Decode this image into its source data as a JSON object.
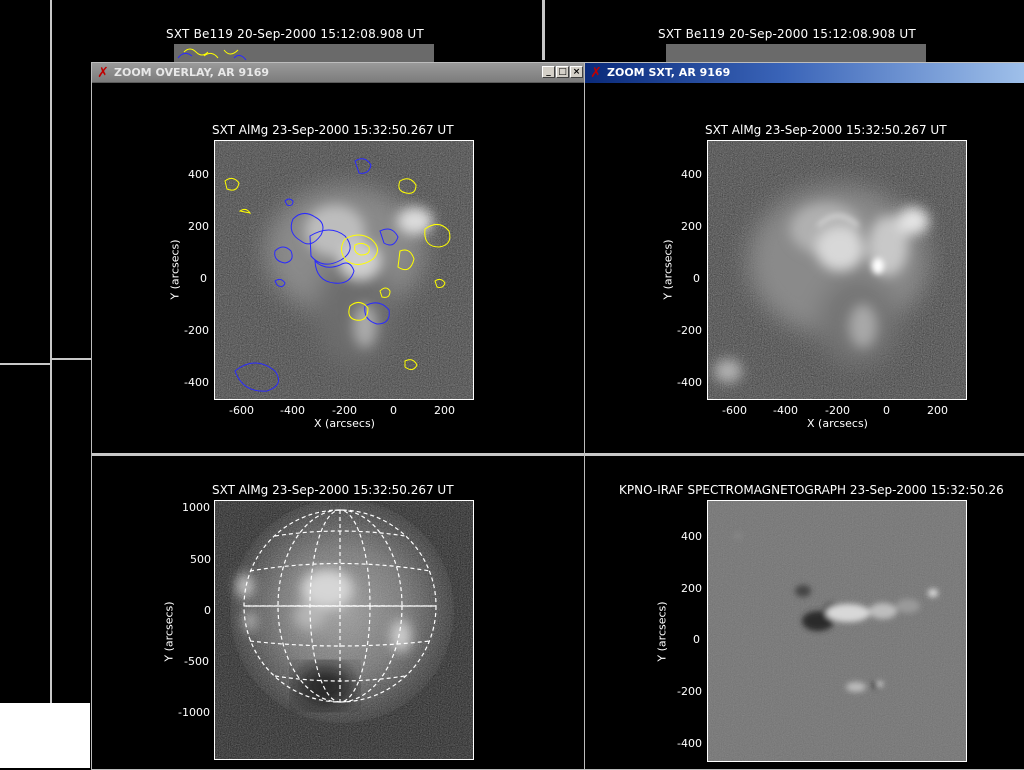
{
  "background": {
    "title_left": "SXT Be119 20-Sep-2000 15:12:08.908 UT",
    "title_right": "SXT Be119 20-Sep-2000 15:12:08.908 UT"
  },
  "windows": {
    "overlay": {
      "title": "ZOOM OVERLAY, AR 9169",
      "buttons": {
        "minimize": "_",
        "maximize": "□",
        "close": "×"
      }
    },
    "sxt": {
      "title": "ZOOM SXT, AR 9169"
    }
  },
  "panels": {
    "overlay": {
      "title": "SXT AlMg 23-Sep-2000 15:32:50.267 UT",
      "xlabel": "X (arcsecs)",
      "ylabel": "Y (arcsecs)",
      "xticks": [
        "-600",
        "-400",
        "-200",
        "0",
        "200"
      ],
      "yticks": [
        "400",
        "200",
        "0",
        "-200",
        "-400"
      ]
    },
    "zoom_sxt": {
      "title": "SXT AlMg 23-Sep-2000 15:32:50.267 UT",
      "xlabel": "X (arcsecs)",
      "ylabel": "Y (arcsecs)",
      "xticks": [
        "-600",
        "-400",
        "-200",
        "0",
        "200"
      ],
      "yticks": [
        "400",
        "200",
        "0",
        "-200",
        "-400"
      ]
    },
    "full_disk": {
      "title": "SXT AlMg 23-Sep-2000 15:32:50.267 UT",
      "ylabel": "Y (arcsecs)",
      "yticks": [
        "1000",
        "500",
        "0",
        "-500",
        "-1000"
      ]
    },
    "magnetogram": {
      "title": "KPNO-IRAF SPECTROMAGNETOGRAPH 23-Sep-2000 15:32:50.26",
      "ylabel": "Y (arcsecs)",
      "yticks": [
        "400",
        "200",
        "0",
        "-200",
        "-400"
      ]
    }
  },
  "colors": {
    "contour_positive": "#ffff00",
    "contour_negative": "#2a2aff",
    "titlebar_active": "#0a2a7a"
  }
}
